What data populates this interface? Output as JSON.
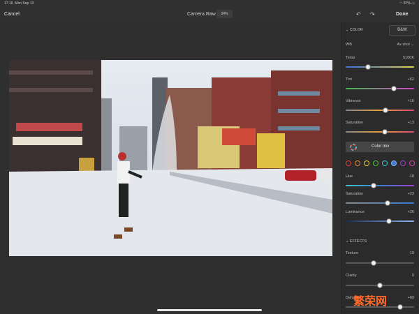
{
  "status_bar": {
    "time": "17:16",
    "date": "Mon Sep 13",
    "battery": "87%"
  },
  "toolbar": {
    "cancel_label": "Cancel",
    "title": "Camera Raw",
    "zoom": "34%",
    "done_label": "Done"
  },
  "panel": {
    "color_section": "COLOR",
    "bw_label": "B&W",
    "wb": {
      "label": "WB",
      "value": "As shot"
    },
    "sliders": [
      {
        "label": "Temp",
        "value": "5100K",
        "pos": 0.33
      },
      {
        "label": "Tint",
        "value": "+62",
        "pos": 0.7
      },
      {
        "label": "Vibrance",
        "value": "+16",
        "pos": 0.58
      },
      {
        "label": "Saturation",
        "value": "+13",
        "pos": 0.57
      }
    ],
    "color_mix_label": "Color mix",
    "mix_sliders": [
      {
        "label": "Hue",
        "value": "-18",
        "pos": 0.41
      },
      {
        "label": "Saturation",
        "value": "+23",
        "pos": 0.61
      },
      {
        "label": "Luminance",
        "value": "+26",
        "pos": 0.63
      }
    ],
    "effects_section": "EFFECTS",
    "effects": [
      {
        "label": "Texture",
        "value": "-19",
        "pos": 0.41
      },
      {
        "label": "Clarity",
        "value": "0",
        "pos": 0.5
      },
      {
        "label": "Dehaze",
        "value": "+60",
        "pos": 0.8
      }
    ]
  },
  "colors": {
    "accent": "#3a7bd5"
  },
  "watermark": "繁荣网"
}
